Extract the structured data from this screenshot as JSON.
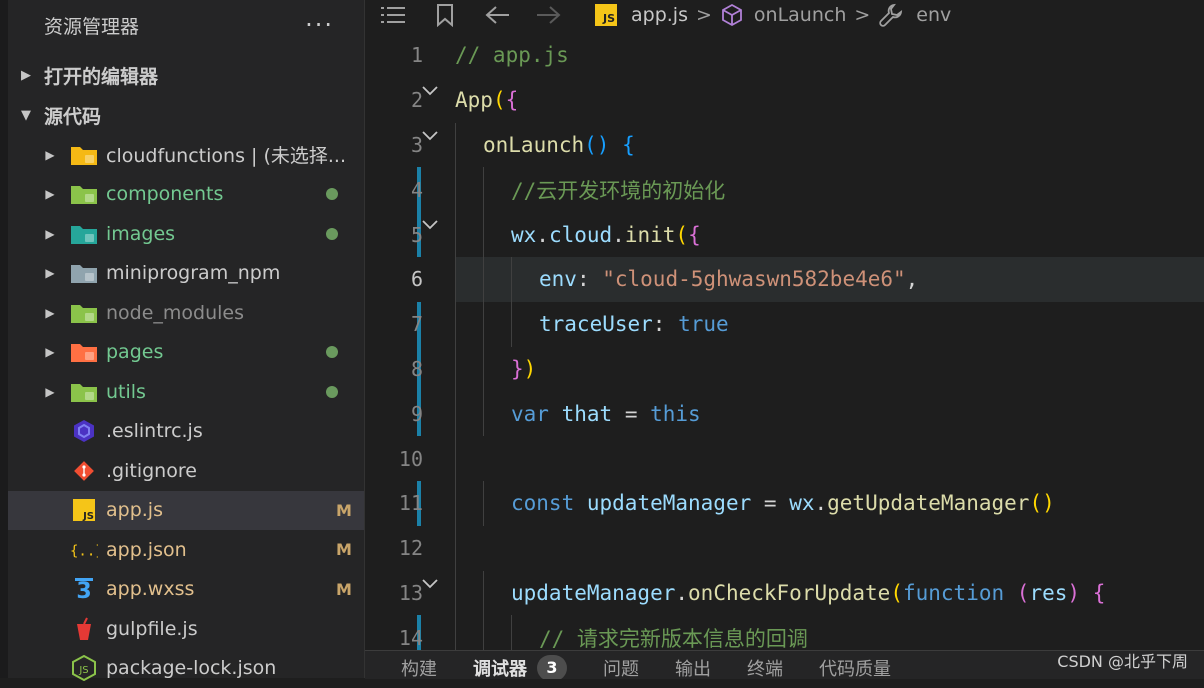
{
  "sidebar": {
    "title": "资源管理器",
    "more": "···",
    "open_editors": "打开的编辑器",
    "source_root": "源代码",
    "items": [
      {
        "name": "cloudfunctions | (未选择...",
        "color": "w",
        "kind": "folder",
        "folder_color": "#f5b915",
        "badge": ""
      },
      {
        "name": "components",
        "color": "g",
        "kind": "folder",
        "folder_color": "#8bc34a",
        "badge": "dot"
      },
      {
        "name": "images",
        "color": "g",
        "kind": "folder",
        "folder_color": "#26a69a",
        "badge": "dot"
      },
      {
        "name": "miniprogram_npm",
        "color": "w",
        "kind": "folder",
        "folder_color": "#90a4ae",
        "badge": ""
      },
      {
        "name": "node_modules",
        "color": "dim",
        "kind": "folder",
        "folder_color": "#8bc34a",
        "badge": ""
      },
      {
        "name": "pages",
        "color": "g",
        "kind": "folder",
        "folder_color": "#ff7043",
        "badge": "dot"
      },
      {
        "name": "utils",
        "color": "g",
        "kind": "folder",
        "folder_color": "#8bc34a",
        "badge": "dot"
      },
      {
        "name": ".eslintrc.js",
        "color": "w",
        "kind": "eslint",
        "badge": ""
      },
      {
        "name": ".gitignore",
        "color": "w",
        "kind": "git",
        "badge": ""
      },
      {
        "name": "app.js",
        "color": "y",
        "kind": "js",
        "badge": "M",
        "selected": true
      },
      {
        "name": "app.json",
        "color": "y",
        "kind": "json",
        "badge": "M"
      },
      {
        "name": "app.wxss",
        "color": "y",
        "kind": "css",
        "badge": "M"
      },
      {
        "name": "gulpfile.js",
        "color": "w",
        "kind": "gulp",
        "badge": ""
      },
      {
        "name": "package-lock.json",
        "color": "w",
        "kind": "node",
        "badge": ""
      }
    ]
  },
  "breadcrumb": {
    "file_icon_text": "JS",
    "file": "app.js",
    "method": "onLaunch",
    "prop": "env",
    "sep": ">"
  },
  "code": {
    "lines": [
      {
        "n": "1",
        "fold": "",
        "bar": false,
        "indent": 0,
        "t": [
          [
            "k-com",
            "// app.js"
          ]
        ]
      },
      {
        "n": "2",
        "fold": "v",
        "bar": false,
        "indent": 0,
        "t": [
          [
            "k-fn",
            "App"
          ],
          [
            "k-br",
            "("
          ],
          [
            "k-br2",
            "{"
          ]
        ]
      },
      {
        "n": "3",
        "fold": "v",
        "bar": false,
        "indent": 1,
        "t": [
          [
            "k-fn",
            "onLaunch"
          ],
          [
            "k-br3",
            "()"
          ],
          [
            "",
            "",
            " "
          ],
          [
            "k-br3",
            "{"
          ]
        ]
      },
      {
        "n": "4",
        "fold": "",
        "bar": true,
        "indent": 2,
        "t": [
          [
            "k-com",
            "//云开发环境的初始化"
          ]
        ]
      },
      {
        "n": "5",
        "fold": "v",
        "bar": true,
        "indent": 2,
        "t": [
          [
            "k-var",
            "wx"
          ],
          [
            "",
            "."
          ],
          [
            "k-var",
            "cloud"
          ],
          [
            "",
            "."
          ],
          [
            "k-fn",
            "init"
          ],
          [
            "k-br",
            "("
          ],
          [
            "k-br2",
            "{"
          ]
        ]
      },
      {
        "n": "6",
        "fold": "",
        "bar": false,
        "indent": 3,
        "cur": true,
        "t": [
          [
            "k-var",
            "env"
          ],
          [
            "",
            ": "
          ],
          [
            "k-str",
            "\"cloud-5ghwaswn582be4e6\""
          ],
          [
            "",
            ","
          ]
        ]
      },
      {
        "n": "7",
        "fold": "",
        "bar": true,
        "indent": 3,
        "t": [
          [
            "k-var",
            "traceUser"
          ],
          [
            "",
            ": "
          ],
          [
            "k-kw",
            "true"
          ]
        ]
      },
      {
        "n": "8",
        "fold": "",
        "bar": true,
        "indent": 2,
        "t": [
          [
            "k-br2",
            "}"
          ],
          [
            "k-br",
            ")"
          ]
        ]
      },
      {
        "n": "9",
        "fold": "",
        "bar": true,
        "indent": 2,
        "t": [
          [
            "k-kw",
            "var"
          ],
          [
            "",
            " "
          ],
          [
            "k-var",
            "that"
          ],
          [
            "",
            " = "
          ],
          [
            "k-kw",
            "this"
          ]
        ]
      },
      {
        "n": "10",
        "fold": "",
        "bar": false,
        "indent": 2,
        "t": []
      },
      {
        "n": "11",
        "fold": "",
        "bar": true,
        "indent": 2,
        "t": [
          [
            "k-kw",
            "const"
          ],
          [
            "",
            " "
          ],
          [
            "k-var",
            "updateManager"
          ],
          [
            "",
            " = "
          ],
          [
            "k-var",
            "wx"
          ],
          [
            "",
            "."
          ],
          [
            "k-fn",
            "getUpdateManager"
          ],
          [
            "k-br",
            "()"
          ]
        ]
      },
      {
        "n": "12",
        "fold": "",
        "bar": false,
        "indent": 2,
        "t": []
      },
      {
        "n": "13",
        "fold": "v",
        "bar": false,
        "indent": 2,
        "t": [
          [
            "k-var",
            "updateManager"
          ],
          [
            "",
            "."
          ],
          [
            "k-fn",
            "onCheckForUpdate"
          ],
          [
            "k-br",
            "("
          ],
          [
            "k-kw",
            "function"
          ],
          [
            "",
            " "
          ],
          [
            "k-br2",
            "("
          ],
          [
            "k-var",
            "res"
          ],
          [
            "k-br2",
            ")"
          ],
          [
            "",
            " "
          ],
          [
            "k-br2",
            "{"
          ]
        ]
      },
      {
        "n": "14",
        "fold": "",
        "bar": true,
        "indent": 3,
        "t": [
          [
            "k-com",
            "// 请求完新版本信息的回调"
          ]
        ]
      }
    ]
  },
  "panel": {
    "tabs": [
      {
        "label": "构建",
        "active": false
      },
      {
        "label": "调试器",
        "active": true,
        "count": "3"
      },
      {
        "label": "问题",
        "active": false
      },
      {
        "label": "输出",
        "active": false
      },
      {
        "label": "终端",
        "active": false
      },
      {
        "label": "代码质量",
        "active": false
      }
    ]
  },
  "watermark": "CSDN @北乎下周"
}
